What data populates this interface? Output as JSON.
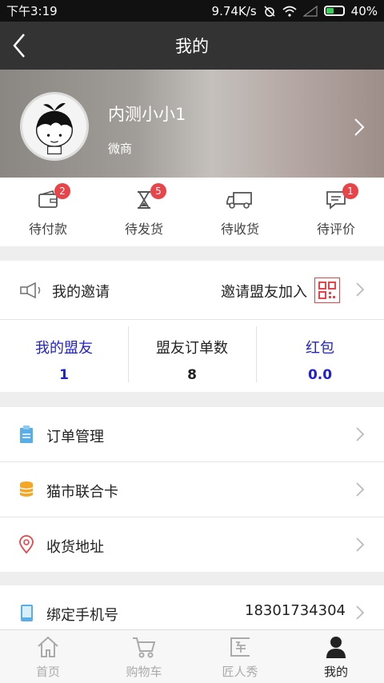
{
  "status": {
    "time": "下午3:19",
    "speed": "9.74K/s",
    "battery": "40%"
  },
  "nav": {
    "title": "我的"
  },
  "profile": {
    "name": "内测小小1",
    "role": "微商"
  },
  "orders": [
    {
      "label": "待付款",
      "badge": "2",
      "icon": "wallet-icon"
    },
    {
      "label": "待发货",
      "badge": "5",
      "icon": "hourglass-icon"
    },
    {
      "label": "待收货",
      "badge": "",
      "icon": "truck-icon"
    },
    {
      "label": "待评价",
      "badge": "1",
      "icon": "comment-icon"
    }
  ],
  "invite": {
    "label": "我的邀请",
    "action": "邀请盟友加入"
  },
  "stats": [
    {
      "label": "我的盟友",
      "value": "1"
    },
    {
      "label": "盟友订单数",
      "value": "8"
    },
    {
      "label": "红包",
      "value": "0.0"
    }
  ],
  "menu": {
    "orders": "订单管理",
    "card": "猫市联合卡",
    "address": "收货地址",
    "phone": "绑定手机号",
    "phone_value": "18301734304"
  },
  "tabs": [
    {
      "label": "首页",
      "icon": "home-icon"
    },
    {
      "label": "购物车",
      "icon": "cart-icon"
    },
    {
      "label": "匠人秀",
      "icon": "craftsman-icon"
    },
    {
      "label": "我的",
      "icon": "person-icon"
    }
  ],
  "colors": {
    "badge": "#e8454a",
    "stat_blue": "#2222cc",
    "navbar": "#333333"
  }
}
